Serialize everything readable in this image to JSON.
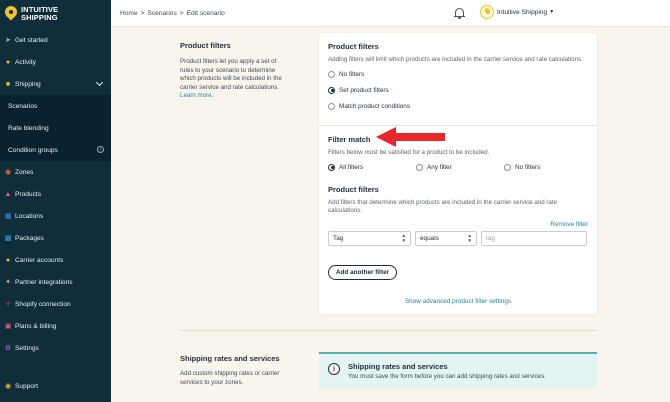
{
  "brand": {
    "line1": "INTUITIVE",
    "line2": "SHIPPING"
  },
  "sidebar": {
    "items": [
      {
        "label": "Get started",
        "icon": "rocket-icon"
      },
      {
        "label": "Activity",
        "icon": "activity-icon"
      },
      {
        "label": "Shipping",
        "icon": "truck-icon"
      },
      {
        "label": "Scenarios"
      },
      {
        "label": "Rate blending"
      },
      {
        "label": "Condition groups"
      },
      {
        "label": "Zones",
        "icon": "zones-icon"
      },
      {
        "label": "Products",
        "icon": "products-icon"
      },
      {
        "label": "Locations",
        "icon": "locations-icon"
      },
      {
        "label": "Packages",
        "icon": "packages-icon"
      },
      {
        "label": "Carrier accounts",
        "icon": "carrier-icon"
      },
      {
        "label": "Partner integrations",
        "icon": "partner-icon"
      },
      {
        "label": "Shopify connection",
        "icon": "shopify-icon"
      },
      {
        "label": "Plans & billing",
        "icon": "billing-icon"
      },
      {
        "label": "Settings",
        "icon": "gear-icon"
      }
    ],
    "support": "Support"
  },
  "topbar": {
    "breadcrumb": [
      "Home",
      "Scenarios",
      "Edit scenario"
    ],
    "separator": ">",
    "account": "Intuitive Shipping"
  },
  "product_filters_section": {
    "title": "Product filters",
    "description": "Product filters let you apply a set of rules to your scenario to determine which products will be included in the carrier service and rate calculations.",
    "learn_more": "Learn more."
  },
  "card": {
    "product_filters": {
      "title": "Product filters",
      "description": "Adding filters will limit which products are included in the carrier service and rate calculations.",
      "options": [
        "No filters",
        "Set product filters",
        "Match product conditions"
      ],
      "selected": "Set product filters"
    },
    "filter_match": {
      "title": "Filter match",
      "description": "Filters below must be satisfied for a product to be included.",
      "options": [
        "All filters",
        "Any filter",
        "No filters"
      ],
      "selected": "All filters"
    },
    "product_filters_rules": {
      "title": "Product filters",
      "description": "Add filters that determine which products are included in the carrier service and rate calculations.",
      "remove": "Remove filter",
      "field": "Tag",
      "operator": "equals",
      "value_placeholder": "tag",
      "add_button": "Add another filter",
      "advanced_link": "Show advanced product filter settings"
    }
  },
  "shipping_section": {
    "title": "Shipping rates and services",
    "description": "Add custom shipping rates or carrier services to your zones.",
    "notice_title": "Shipping rates and services",
    "notice_text": "You must save the form before you can add shipping rates and services."
  },
  "colors": {
    "sidebar": "#0f2d3b",
    "accent": "#2283a8",
    "brand": "#f4c12f",
    "annotation": "#e8262b"
  }
}
